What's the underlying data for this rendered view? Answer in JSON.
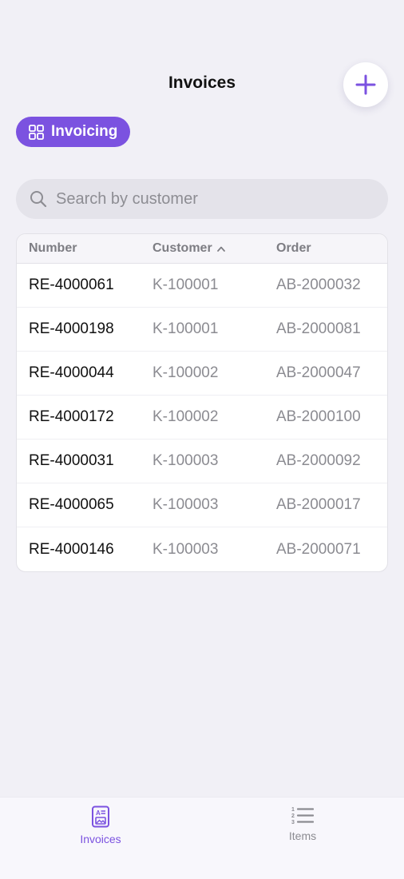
{
  "header": {
    "title": "Invoices",
    "add_icon": "plus-icon"
  },
  "chip": {
    "label": "Invoicing",
    "icon": "grid-icon"
  },
  "search": {
    "placeholder": "Search by customer",
    "value": "",
    "icon": "search-icon"
  },
  "table": {
    "columns": [
      "Number",
      "Customer",
      "Order"
    ],
    "sorted_column": "Customer",
    "sort_direction": "ascending",
    "rows": [
      {
        "number": "RE-4000061",
        "customer": "K-100001",
        "order": "AB-2000032"
      },
      {
        "number": "RE-4000198",
        "customer": "K-100001",
        "order": "AB-2000081"
      },
      {
        "number": "RE-4000044",
        "customer": "K-100002",
        "order": "AB-2000047"
      },
      {
        "number": "RE-4000172",
        "customer": "K-100002",
        "order": "AB-2000100"
      },
      {
        "number": "RE-4000031",
        "customer": "K-100003",
        "order": "AB-2000092"
      },
      {
        "number": "RE-4000065",
        "customer": "K-100003",
        "order": "AB-2000017"
      },
      {
        "number": "RE-4000146",
        "customer": "K-100003",
        "order": "AB-2000071"
      }
    ]
  },
  "tabbar": {
    "tabs": [
      {
        "label": "Invoices",
        "icon": "invoice-document-icon",
        "active": true
      },
      {
        "label": "Items",
        "icon": "numbered-list-icon",
        "active": false
      }
    ]
  },
  "colors": {
    "accent": "#7b52e0",
    "background": "#f1f0f6",
    "muted_text": "#8b8b91"
  }
}
